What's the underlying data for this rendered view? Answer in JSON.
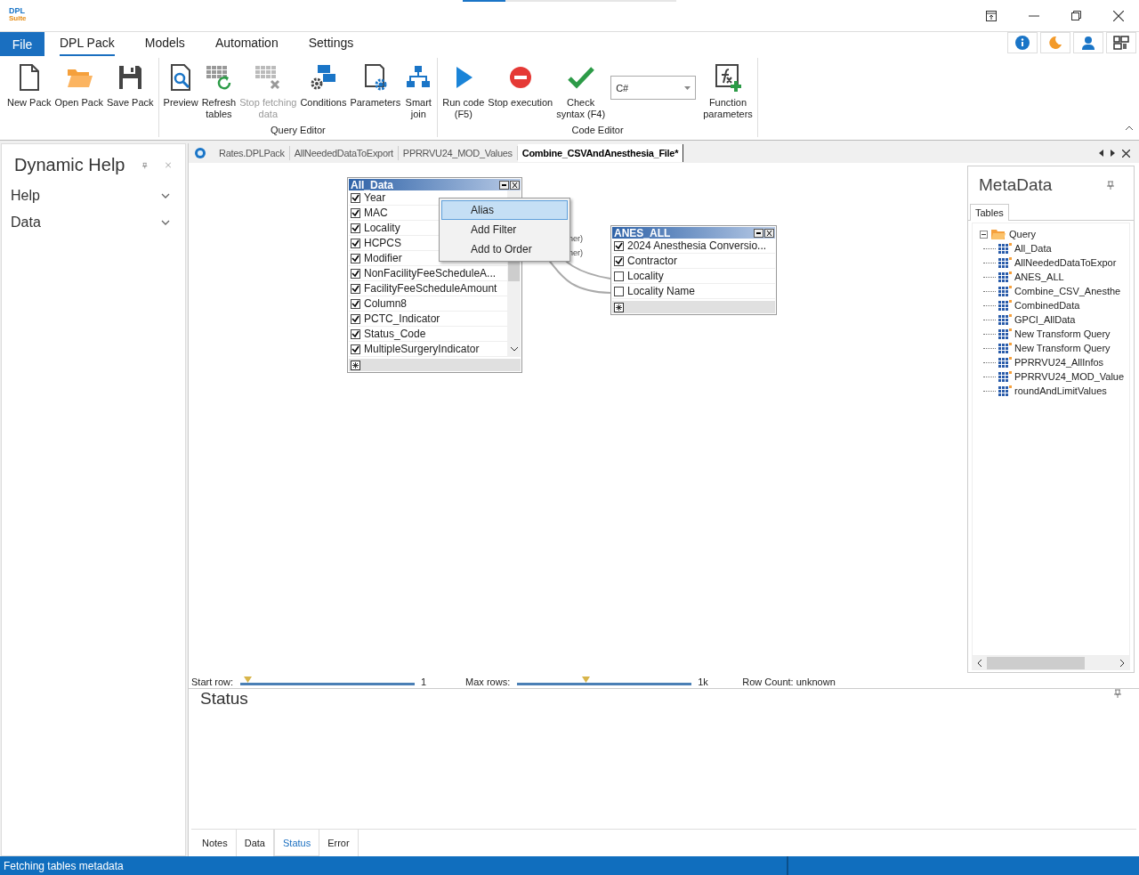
{
  "app": {
    "logo_top": "DPL",
    "logo_bottom": "Suite",
    "loading_bar": {
      "level": 0.2
    }
  },
  "menu_tabs": [
    {
      "label": "File",
      "kind": "file",
      "selected": false
    },
    {
      "label": "DPL Pack",
      "kind": "tab",
      "selected": true
    },
    {
      "label": "Models",
      "kind": "tab",
      "selected": false
    },
    {
      "label": "Automation",
      "kind": "tab",
      "selected": false
    },
    {
      "label": "Settings",
      "kind": "tab",
      "selected": false
    }
  ],
  "ribbon": {
    "groups": [
      {
        "buttons": [
          {
            "lines": [
              "New Pack"
            ],
            "disabled": false
          },
          {
            "lines": [
              "Open Pack"
            ],
            "disabled": false
          },
          {
            "lines": [
              "Save Pack"
            ],
            "disabled": false
          }
        ]
      },
      {
        "label": "Query Editor",
        "buttons": [
          {
            "lines": [
              "Preview"
            ],
            "disabled": false
          },
          {
            "lines": [
              "Refresh",
              "tables"
            ],
            "disabled": false
          },
          {
            "lines": [
              "Stop fetching",
              "data"
            ],
            "disabled": true
          },
          {
            "lines": [
              "Conditions"
            ],
            "disabled": false
          },
          {
            "lines": [
              "Parameters"
            ],
            "disabled": false
          },
          {
            "lines": [
              "Smart",
              "join"
            ],
            "disabled": false
          }
        ]
      },
      {
        "label": "Code Editor",
        "buttons": [
          {
            "lines": [
              "Run code",
              "(F5)"
            ],
            "disabled": false
          },
          {
            "lines": [
              "Stop execution"
            ],
            "disabled": false
          },
          {
            "lines": [
              "Check",
              "syntax (F4)"
            ],
            "disabled": false
          },
          {
            "kind": "combo",
            "value": "C#"
          },
          {
            "lines": [
              "Function",
              "parameters"
            ],
            "disabled": false
          }
        ]
      }
    ]
  },
  "dynamic_help": {
    "title": "Dynamic Help",
    "sections": [
      {
        "label": "Help",
        "expanded": false
      },
      {
        "label": "Data",
        "expanded": false
      }
    ]
  },
  "document_tabs": [
    {
      "label": "Rates.DPLPack",
      "selected": false
    },
    {
      "label": "AllNeededDataToExport",
      "selected": false
    },
    {
      "label": "PPRRVU24_MOD_Values",
      "selected": false
    },
    {
      "label": "Combine_CSVAndAnesthesia_File*",
      "selected": true
    }
  ],
  "canvas": {
    "tables": [
      {
        "title": "All_Data",
        "scrollbar": true,
        "fields": [
          {
            "name": "Year",
            "checked": true
          },
          {
            "name": "MAC",
            "checked": true
          },
          {
            "name": "Locality",
            "checked": true
          },
          {
            "name": "HCPCS",
            "checked": true
          },
          {
            "name": "Modifier",
            "checked": true
          },
          {
            "name": "NonFacilityFeeScheduleA...",
            "checked": true
          },
          {
            "name": "FacilityFeeScheduleAmount",
            "checked": true
          },
          {
            "name": "Column8",
            "checked": true
          },
          {
            "name": "PCTC_Indicator",
            "checked": true
          },
          {
            "name": "Status_Code",
            "checked": true
          },
          {
            "name": "MultipleSurgeryIndicator",
            "checked": true
          }
        ]
      },
      {
        "title": "ANES_ALL",
        "scrollbar": false,
        "fields": [
          {
            "name": "2024 Anesthesia Conversio...",
            "checked": true
          },
          {
            "name": "Contractor",
            "checked": true
          },
          {
            "name": "Locality",
            "checked": false
          },
          {
            "name": "Locality Name",
            "checked": false
          }
        ]
      }
    ],
    "join_labels": [
      "ner)",
      "ner)"
    ],
    "context_menu": [
      {
        "label": "Alias",
        "selected": true
      },
      {
        "label": "Add Filter",
        "selected": false
      },
      {
        "label": "Add to Order",
        "selected": false
      }
    ]
  },
  "metadata": {
    "title": "MetaData",
    "tab": "Tables",
    "tree": {
      "label": "Query",
      "expanded": true,
      "children": [
        {
          "label": "All_Data"
        },
        {
          "label": "AllNeededDataToExpor"
        },
        {
          "label": "ANES_ALL"
        },
        {
          "label": "Combine_CSV_Anesthe"
        },
        {
          "label": "CombinedData"
        },
        {
          "label": "GPCI_AllData"
        },
        {
          "label": "New Transform Query"
        },
        {
          "label": "New Transform Query"
        },
        {
          "label": "PPRRVU24_AllInfos"
        },
        {
          "label": "PPRRVU24_MOD_Value"
        },
        {
          "label": "roundAndLimitValues"
        }
      ]
    }
  },
  "query_options": {
    "start_row": {
      "label": "Start row:",
      "level": 0.02,
      "value": "1"
    },
    "max_rows": {
      "label": "Max rows:",
      "level": 0.37,
      "value": "1k"
    },
    "row_count": "Row Count: unknown"
  },
  "status_panel": {
    "title": "Status",
    "tabs": [
      {
        "label": "Notes",
        "selected": false
      },
      {
        "label": "Data",
        "selected": false
      },
      {
        "label": "Status",
        "selected": true
      },
      {
        "label": "Error",
        "selected": false
      }
    ]
  },
  "status_bar": "Fetching tables metadata"
}
